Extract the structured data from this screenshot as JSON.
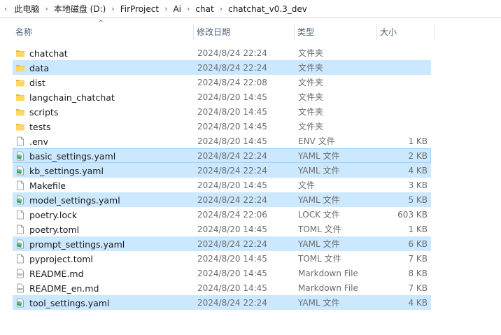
{
  "breadcrumb": [
    "此电脑",
    "本地磁盘 (D:)",
    "FirProject",
    "Ai",
    "chat",
    "chatchat_v0.3_dev"
  ],
  "columns": {
    "name": "名称",
    "date": "修改日期",
    "type": "类型",
    "size": "大小"
  },
  "files": [
    {
      "name": "chatchat",
      "date": "2024/8/24 22:24",
      "type": "文件夹",
      "size": "",
      "icon": "folder-icon",
      "state": ""
    },
    {
      "name": "data",
      "date": "2024/8/24 22:24",
      "type": "文件夹",
      "size": "",
      "icon": "folder-icon",
      "state": "sel"
    },
    {
      "name": "dist",
      "date": "2024/8/24 22:08",
      "type": "文件夹",
      "size": "",
      "icon": "folder-icon",
      "state": ""
    },
    {
      "name": "langchain_chatchat",
      "date": "2024/8/20 14:45",
      "type": "文件夹",
      "size": "",
      "icon": "folder-icon",
      "state": ""
    },
    {
      "name": "scripts",
      "date": "2024/8/20 14:45",
      "type": "文件夹",
      "size": "",
      "icon": "folder-icon",
      "state": ""
    },
    {
      "name": "tests",
      "date": "2024/8/20 14:45",
      "type": "文件夹",
      "size": "",
      "icon": "folder-icon",
      "state": ""
    },
    {
      "name": ".env",
      "date": "2024/8/20 14:45",
      "type": "ENV 文件",
      "size": "1 KB",
      "icon": "blank-file-icon",
      "state": ""
    },
    {
      "name": "basic_settings.yaml",
      "date": "2024/8/24 22:24",
      "type": "YAML 文件",
      "size": "2 KB",
      "icon": "yaml-file-icon",
      "state": "sel-border"
    },
    {
      "name": "kb_settings.yaml",
      "date": "2024/8/24 22:24",
      "type": "YAML 文件",
      "size": "4 KB",
      "icon": "yaml-file-icon",
      "state": "sel"
    },
    {
      "name": "Makefile",
      "date": "2024/8/20 14:45",
      "type": "文件",
      "size": "3 KB",
      "icon": "blank-file-icon",
      "state": ""
    },
    {
      "name": "model_settings.yaml",
      "date": "2024/8/24 22:24",
      "type": "YAML 文件",
      "size": "5 KB",
      "icon": "yaml-file-icon",
      "state": "sel"
    },
    {
      "name": "poetry.lock",
      "date": "2024/8/24 22:06",
      "type": "LOCK 文件",
      "size": "603 KB",
      "icon": "blank-file-icon",
      "state": ""
    },
    {
      "name": "poetry.toml",
      "date": "2024/8/20 14:45",
      "type": "TOML 文件",
      "size": "1 KB",
      "icon": "blank-file-icon",
      "state": ""
    },
    {
      "name": "prompt_settings.yaml",
      "date": "2024/8/24 22:24",
      "type": "YAML 文件",
      "size": "6 KB",
      "icon": "yaml-file-icon",
      "state": "sel"
    },
    {
      "name": "pyproject.toml",
      "date": "2024/8/20 14:45",
      "type": "TOML 文件",
      "size": "7 KB",
      "icon": "blank-file-icon",
      "state": ""
    },
    {
      "name": "README.md",
      "date": "2024/8/20 14:45",
      "type": "Markdown File",
      "size": "8 KB",
      "icon": "markdown-file-icon",
      "state": ""
    },
    {
      "name": "README_en.md",
      "date": "2024/8/20 14:45",
      "type": "Markdown File",
      "size": "7 KB",
      "icon": "markdown-file-icon",
      "state": ""
    },
    {
      "name": "tool_settings.yaml",
      "date": "2024/8/24 22:24",
      "type": "YAML 文件",
      "size": "4 KB",
      "icon": "yaml-file-icon",
      "state": "sel"
    }
  ]
}
